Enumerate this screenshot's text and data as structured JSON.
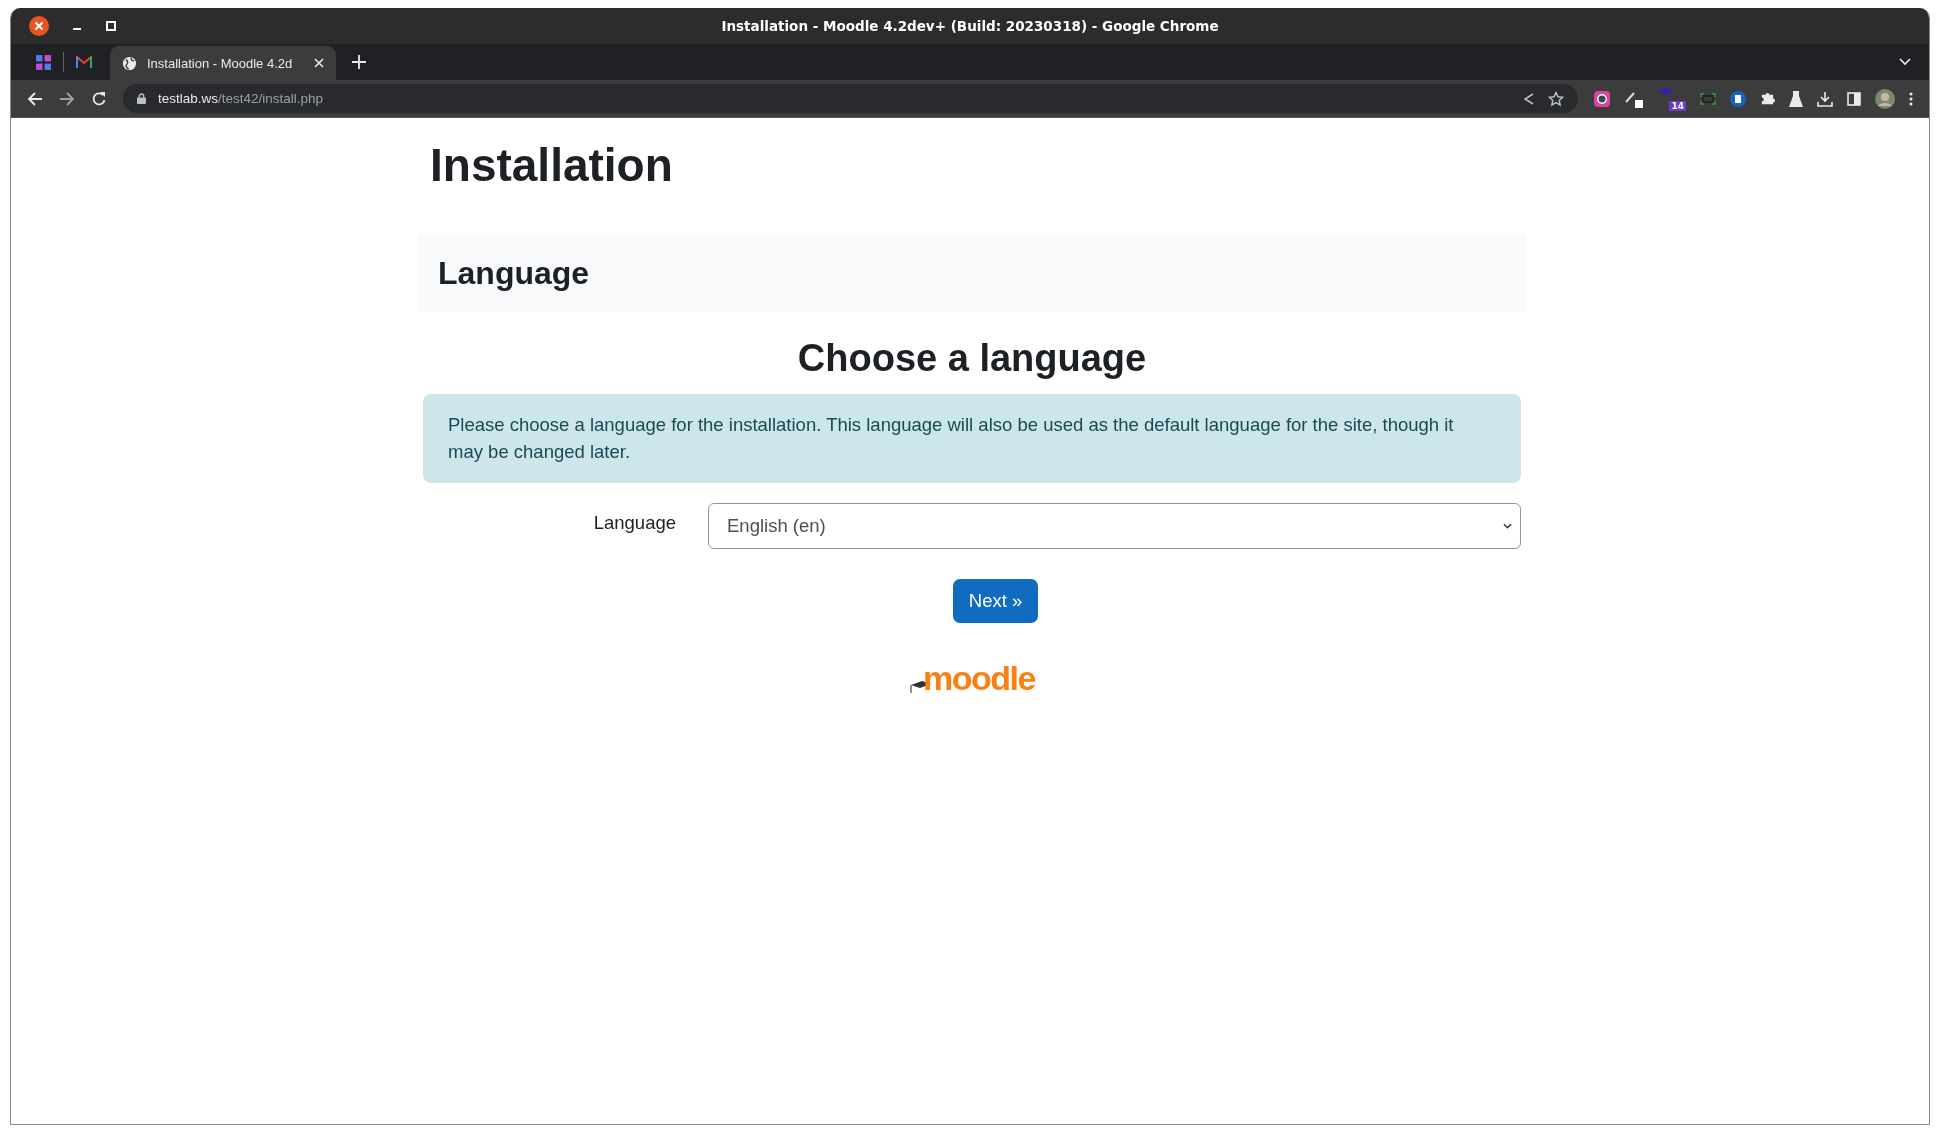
{
  "window": {
    "title": "Installation - Moodle 4.2dev+ (Build: 20230318) - Google Chrome"
  },
  "tabs": [
    {
      "kind": "pinned",
      "selected": false
    },
    {
      "kind": "pinned-mail",
      "selected": false
    },
    {
      "kind": "page",
      "label": "Installation - Moodle 4.2d",
      "selected": true
    }
  ],
  "address_bar": {
    "host": "testlab.ws",
    "path": "/test42/install.php"
  },
  "extension_badge": "14",
  "page": {
    "heading": "Installation",
    "section_title": "Language",
    "subheading": "Choose a language",
    "notice": "Please choose a language for the installation. This language will also be used as the default language for the site, though it may be changed later.",
    "language_field": {
      "label": "Language",
      "value": "English (en)"
    },
    "next_button": "Next »",
    "logo": "moodle"
  }
}
